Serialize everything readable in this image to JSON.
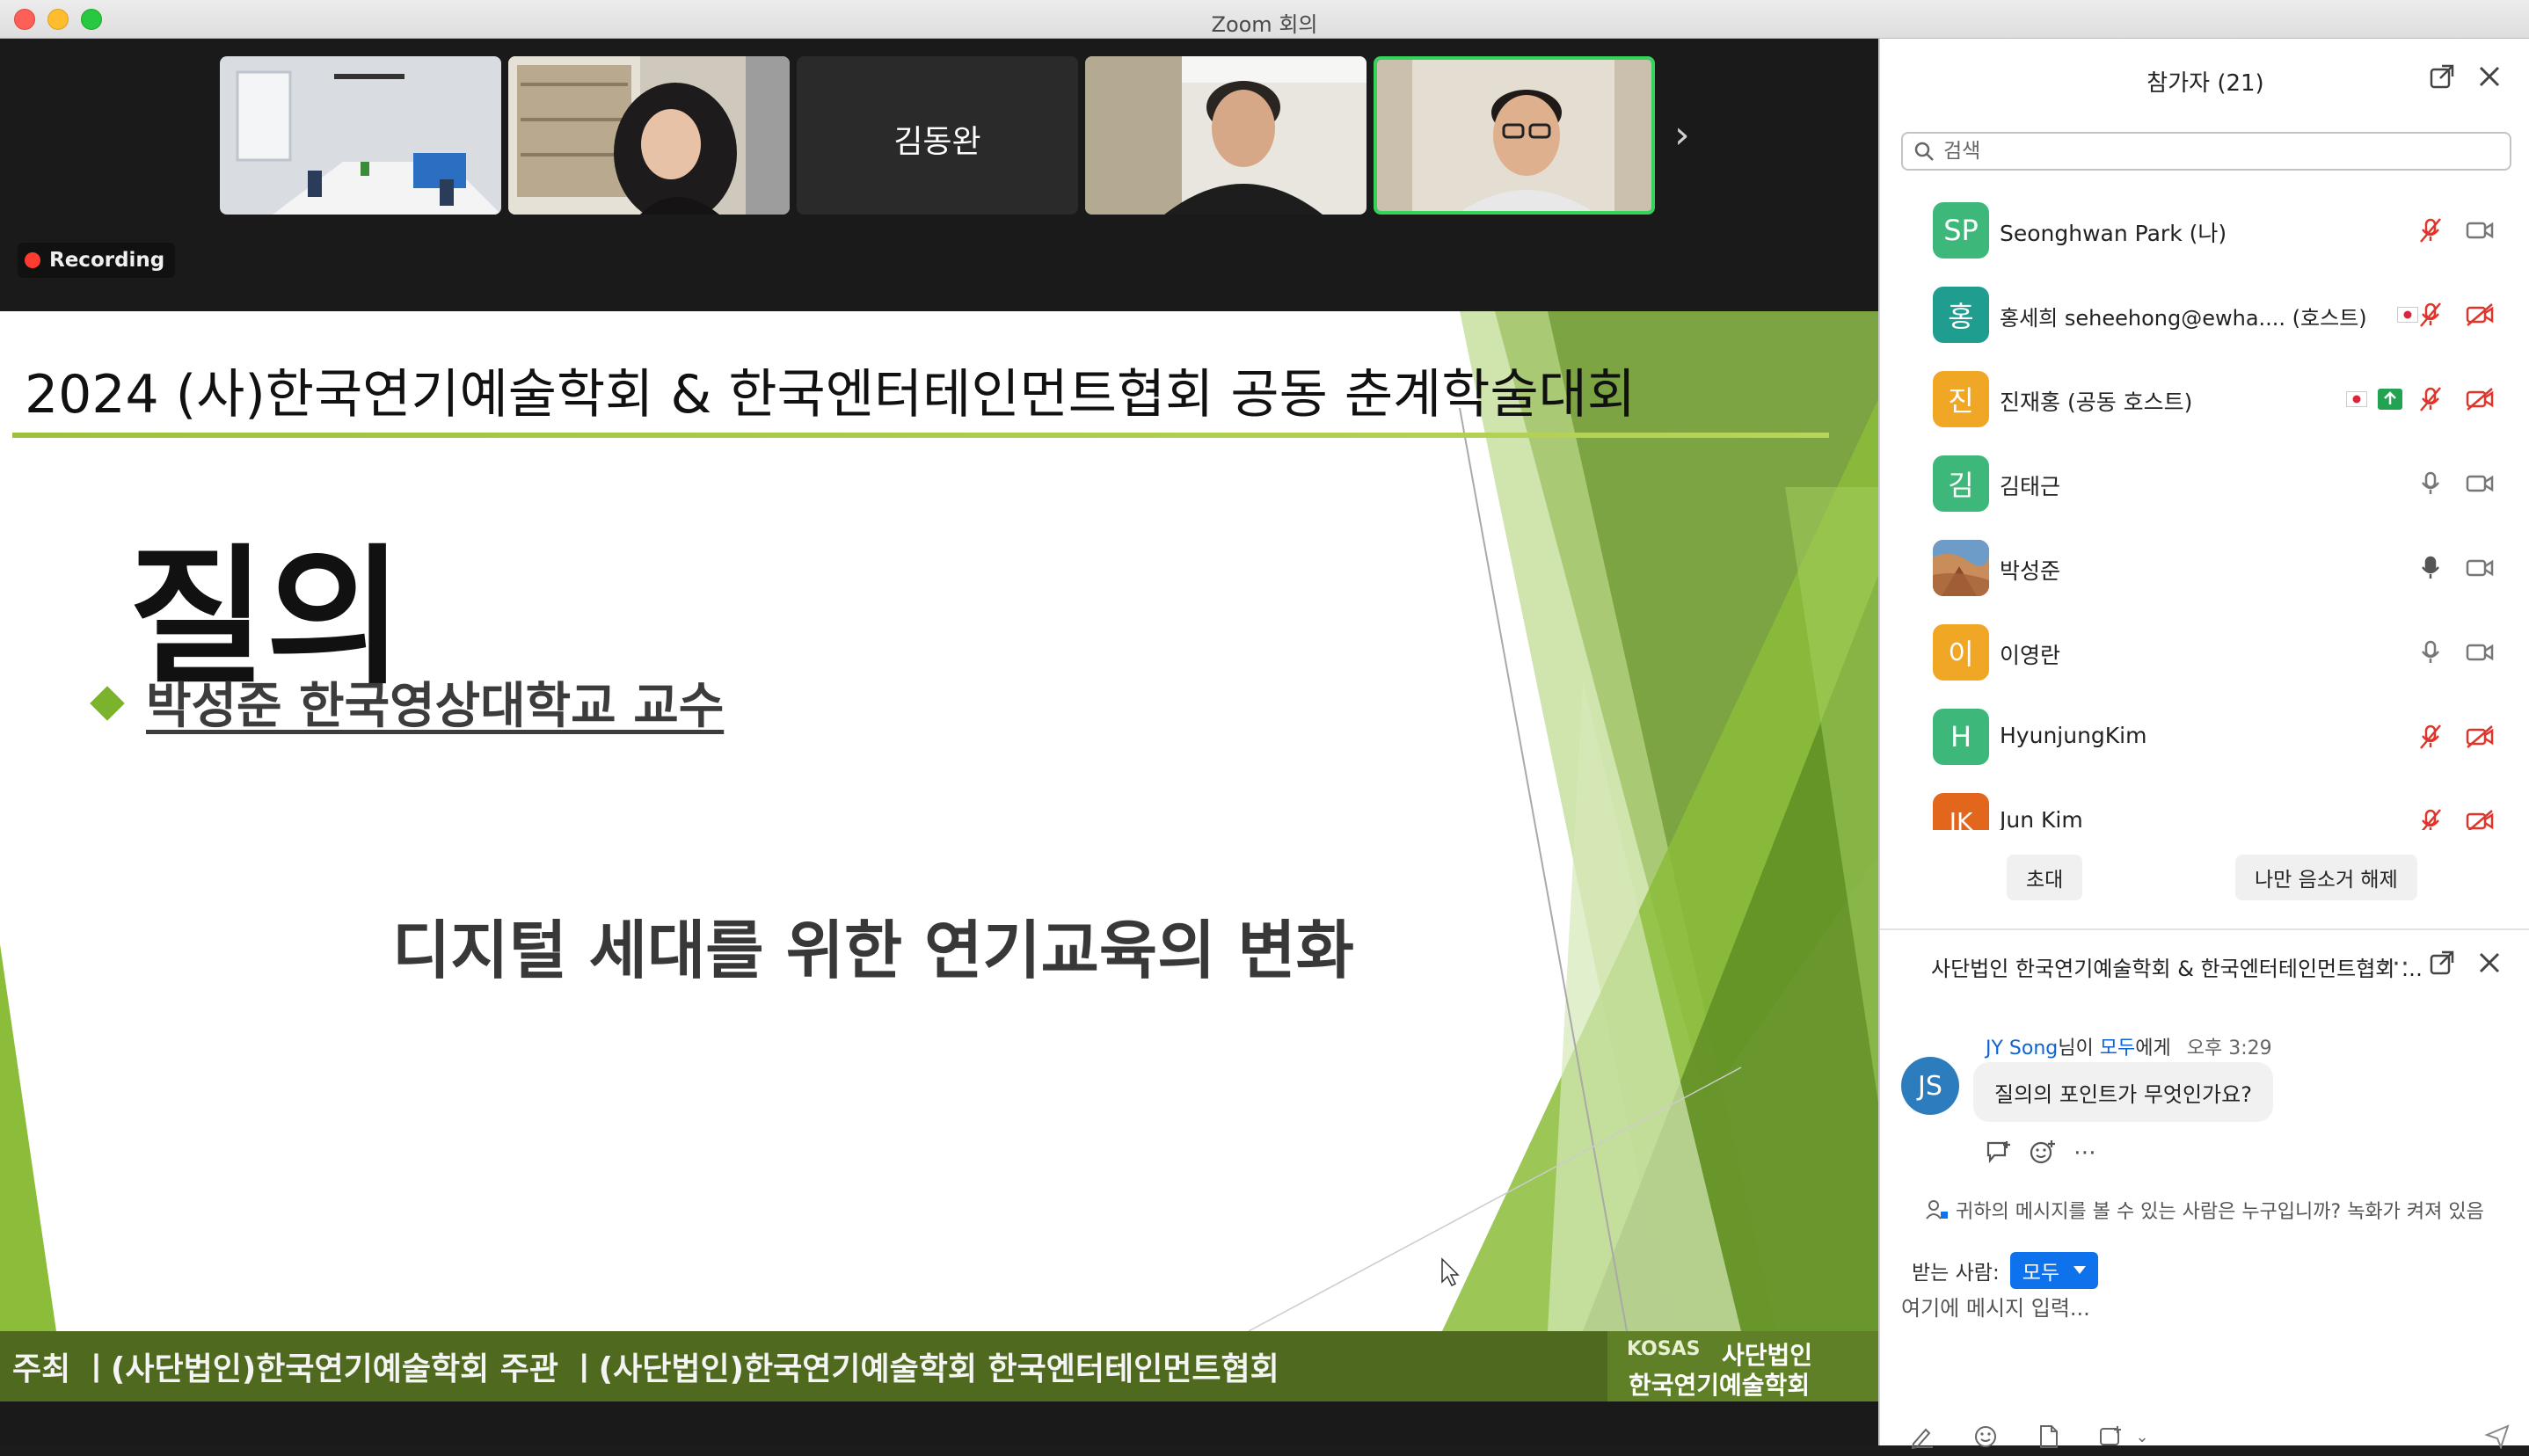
{
  "window": {
    "title": "Zoom 회의"
  },
  "meeting": {
    "recording_label": "Recording",
    "gallery": [
      {
        "type": "video",
        "desc": "room"
      },
      {
        "type": "video",
        "desc": "woman"
      },
      {
        "type": "name",
        "name": "김동완"
      },
      {
        "type": "video",
        "desc": "man"
      },
      {
        "type": "video",
        "desc": "man-glasses",
        "active": true
      }
    ]
  },
  "slide": {
    "header": "2024 (사)한국연기예술학회 & 한국엔터테인먼트협회 공동 춘계학술대회",
    "heading": "질의",
    "presenter": "박성준 한국영상대학교 교수",
    "subtitle": "디지털 세대를 위한 연기교육의 변화",
    "footer": "주최 ㅣ(사단법인)한국연기예술학회   주관 ㅣ(사단법인)한국연기예술학회   한국엔터테인먼트협회",
    "logo": {
      "mark": "KOSAS",
      "line1": "사단법인",
      "line2": "한국연기예술학회"
    }
  },
  "participants": {
    "title": "참가자 (21)",
    "search_placeholder": "검색",
    "list": [
      {
        "initial": "SP",
        "name": "Seonghwan Park (나)",
        "color": "#3eb87a",
        "mic": "muted",
        "video": "on"
      },
      {
        "initial": "홍",
        "name": "홍세희 seheehong@ewha.... (호스트)",
        "color": "#1f9e8f",
        "mic": "muted",
        "video": "off",
        "flag": true
      },
      {
        "initial": "진",
        "name": "진재홍 (공동 호스트)",
        "color": "#f0a725",
        "mic": "muted",
        "video": "off",
        "flag": true,
        "share": true
      },
      {
        "initial": "김",
        "name": "김태근",
        "color": "#3eb87a",
        "mic": "on",
        "video": "on"
      },
      {
        "initial": "",
        "name": "박성준",
        "color": "#a3694a",
        "mic": "active",
        "video": "on",
        "photo": true
      },
      {
        "initial": "이",
        "name": "이영란",
        "color": "#f0a725",
        "mic": "on",
        "video": "on"
      },
      {
        "initial": "H",
        "name": "HyunjungKim",
        "color": "#3eb87a",
        "mic": "muted",
        "video": "off"
      },
      {
        "initial": "JK",
        "name": "Jun Kim",
        "color": "#e2661c",
        "mic": "muted",
        "video": "off"
      }
    ],
    "invite_label": "초대",
    "unmute_label": "나만 음소거 해제"
  },
  "chat": {
    "title": "사단법인 한국연기예술학회 & 한국엔터테인먼트협회 공동 춘계학술대회",
    "message": {
      "avatar": "JS",
      "sender": "JY Song",
      "sender_suffix": "님이 ",
      "recipient": "모두",
      "recipient_suffix": "에게",
      "time": "오후 3:29",
      "text": "질의의 포인트가 무엇인가요?"
    },
    "privacy_note": "귀하의 메시지를 볼 수 있는 사람은 누구입니까? 녹화가 켜져 있음",
    "to_label": "받는 사람:",
    "to_value": "모두",
    "input_placeholder": "여기에 메시지 입력..."
  }
}
